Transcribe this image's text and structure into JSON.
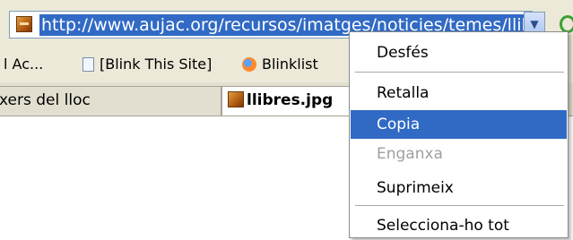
{
  "address_bar": {
    "url": "http://www.aujac.org/recursos/imatges/noticies/temes/llibres.jpg"
  },
  "bookmarks": [
    {
      "label": "l Ac..."
    },
    {
      "label": "[Blink This Site]"
    },
    {
      "label": "Blinklist"
    }
  ],
  "tabs": [
    {
      "label": "xers del lloc",
      "active": false
    },
    {
      "label": "llibres.jpg",
      "active": true
    }
  ],
  "context_menu": {
    "items": [
      {
        "label": "Desfés",
        "state": "normal"
      },
      {
        "label": "Retalla",
        "state": "normal"
      },
      {
        "label": "Copia",
        "state": "highlighted"
      },
      {
        "label": "Enganxa",
        "state": "disabled"
      },
      {
        "label": "Suprimeix",
        "state": "normal"
      },
      {
        "label": "Selecciona-ho tot",
        "state": "normal"
      }
    ]
  },
  "colors": {
    "selection": "#316ac5",
    "chrome": "#ece9d8",
    "disabled_text": "#a0a0a0"
  }
}
